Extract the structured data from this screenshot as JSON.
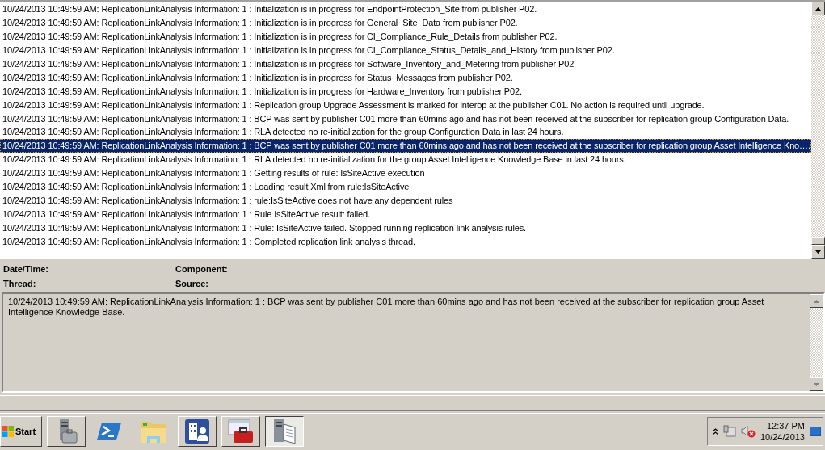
{
  "log": {
    "rows": [
      {
        "text": "10/24/2013 10:49:59 AM: ReplicationLinkAnalysis Information: 1 : Initialization is in progress for EndpointProtection_Site from publisher P02.",
        "selected": false
      },
      {
        "text": "10/24/2013 10:49:59 AM: ReplicationLinkAnalysis Information: 1 : Initialization is in progress for General_Site_Data from publisher P02.",
        "selected": false
      },
      {
        "text": "10/24/2013 10:49:59 AM: ReplicationLinkAnalysis Information: 1 : Initialization is in progress for CI_Compliance_Rule_Details from publisher P02.",
        "selected": false
      },
      {
        "text": "10/24/2013 10:49:59 AM: ReplicationLinkAnalysis Information: 1 : Initialization is in progress for CI_Compliance_Status_Details_and_History from publisher P02.",
        "selected": false
      },
      {
        "text": "10/24/2013 10:49:59 AM: ReplicationLinkAnalysis Information: 1 : Initialization is in progress for Software_Inventory_and_Metering from publisher P02.",
        "selected": false
      },
      {
        "text": "10/24/2013 10:49:59 AM: ReplicationLinkAnalysis Information: 1 : Initialization is in progress for Status_Messages from publisher P02.",
        "selected": false
      },
      {
        "text": "10/24/2013 10:49:59 AM: ReplicationLinkAnalysis Information: 1 : Initialization is in progress for Hardware_Inventory from publisher P02.",
        "selected": false
      },
      {
        "text": "10/24/2013 10:49:59 AM: ReplicationLinkAnalysis Information: 1 : Replication group Upgrade Assessment is marked for interop at the publisher C01. No action is required until upgrade.",
        "selected": false
      },
      {
        "text": "10/24/2013 10:49:59 AM: ReplicationLinkAnalysis Information: 1 : BCP was sent by publisher C01 more than 60mins ago and has not been received at the subscriber for replication group Configuration Data.",
        "selected": false
      },
      {
        "text": "10/24/2013 10:49:59 AM: ReplicationLinkAnalysis Information: 1 : RLA detected no re-initialization for the group Configuration Data in last 24 hours.",
        "selected": false
      },
      {
        "text": "10/24/2013 10:49:59 AM: ReplicationLinkAnalysis Information: 1 : BCP was sent by publisher C01 more than 60mins ago and has not been received at the subscriber for replication group Asset Intelligence Kno….",
        "selected": true
      },
      {
        "text": "10/24/2013 10:49:59 AM: ReplicationLinkAnalysis Information: 1 : RLA detected no re-initialization for the group Asset Intelligence Knowledge Base in last 24 hours.",
        "selected": false
      },
      {
        "text": "10/24/2013 10:49:59 AM: ReplicationLinkAnalysis Information: 1 : Getting results of rule: IsSiteActive execution",
        "selected": false
      },
      {
        "text": "10/24/2013 10:49:59 AM: ReplicationLinkAnalysis Information: 1 : Loading result Xml from rule:IsSiteActive",
        "selected": false
      },
      {
        "text": "10/24/2013 10:49:59 AM: ReplicationLinkAnalysis Information: 1 : rule:IsSiteActive does not have any dependent rules",
        "selected": false
      },
      {
        "text": "10/24/2013 10:49:59 AM: ReplicationLinkAnalysis Information: 1 : Rule IsSiteActive result: failed.",
        "selected": false
      },
      {
        "text": "10/24/2013 10:49:59 AM: ReplicationLinkAnalysis Information: 1 : Rule: IsSiteActive failed. Stopped running replication link analysis rules.",
        "selected": false
      },
      {
        "text": "10/24/2013 10:49:59 AM: ReplicationLinkAnalysis Information: 1 : Completed replication link analysis thread.",
        "selected": false
      }
    ]
  },
  "details": {
    "fields": [
      {
        "label": "Date/Time:"
      },
      {
        "label": "Component:"
      },
      {
        "label": "Thread:"
      },
      {
        "label": "Source:"
      }
    ],
    "message": "10/24/2013 10:49:59 AM: ReplicationLinkAnalysis Information: 1 : BCP was sent by publisher C01 more than 60mins ago and has not been received at the subscriber for replication group Asset Intelligence Knowledge Base."
  },
  "taskbar": {
    "start": "Start",
    "apps": [
      {
        "kind": "server-manager",
        "selected": false
      },
      {
        "kind": "powershell",
        "selected": false
      },
      {
        "kind": "explorer",
        "selected": false
      },
      {
        "kind": "users",
        "selected": false
      },
      {
        "kind": "toolbox",
        "selected": false
      },
      {
        "kind": "log-viewer",
        "selected": true
      }
    ],
    "time": "12:37 PM",
    "date": "10/24/2013"
  }
}
